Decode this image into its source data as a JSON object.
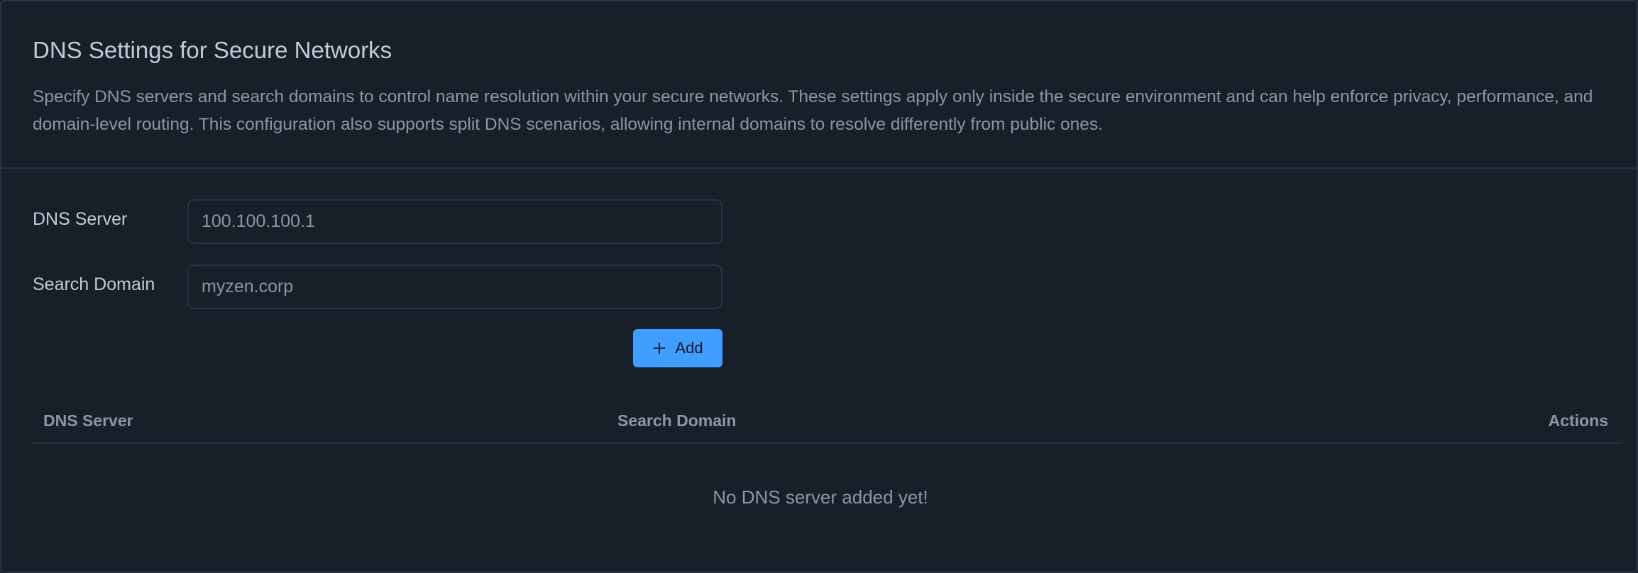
{
  "header": {
    "title": "DNS Settings for Secure Networks",
    "description": "Specify DNS servers and search domains to control name resolution within your secure networks. These settings apply only inside the secure environment and can help enforce privacy, performance, and domain-level routing. This configuration also supports split DNS scenarios, allowing internal domains to resolve differently from public ones."
  },
  "form": {
    "dns_server_label": "DNS Server",
    "dns_server_value": "100.100.100.1",
    "search_domain_label": "Search Domain",
    "search_domain_value": "myzen.corp",
    "add_label": "Add"
  },
  "table": {
    "columns": [
      "DNS Server",
      "Search Domain",
      "Actions"
    ],
    "rows": [],
    "empty_text": "No DNS server added yet!"
  },
  "colors": {
    "accent": "#409eff",
    "background": "#191f29"
  }
}
